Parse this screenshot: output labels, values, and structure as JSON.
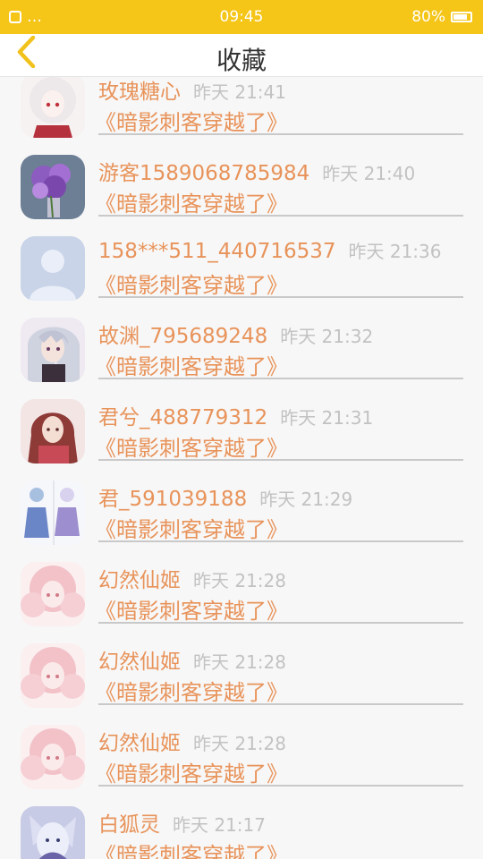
{
  "status_bar": {
    "time": "09:45",
    "carrier": "…",
    "battery": "80%"
  },
  "header": {
    "title": "收藏",
    "back_icon": "chevron-left-icon",
    "accent": "#f5c518"
  },
  "colors": {
    "name": "#e8935a",
    "time": "#c2c2c2",
    "book": "#e8935a"
  },
  "items": [
    {
      "name": "玫瑰糖心",
      "time": "昨天 21:41",
      "book": "《暗影刺客穿越了》",
      "avatar": "anime-girl-white-hair"
    },
    {
      "name": "游客1589068785984",
      "time": "昨天 21:40",
      "book": "《暗影刺客穿越了》",
      "avatar": "purple-hydrangea"
    },
    {
      "name": "158***511_440716537",
      "time": "昨天 21:36",
      "book": "《暗影刺客穿越了》",
      "avatar": "default-user"
    },
    {
      "name": "故渊_795689248",
      "time": "昨天 21:32",
      "book": "《暗影刺客穿越了》",
      "avatar": "anime-boy-silver-hair"
    },
    {
      "name": "君兮_488779312",
      "time": "昨天 21:31",
      "book": "《暗影刺客穿越了》",
      "avatar": "anime-girl-red-hair"
    },
    {
      "name": "君_591039188",
      "time": "昨天 21:29",
      "book": "《暗影刺客穿越了》",
      "avatar": "anime-dolls-blue-dress"
    },
    {
      "name": "幻然仙姬",
      "time": "昨天 21:28",
      "book": "《暗影刺客穿越了》",
      "avatar": "anime-girl-pink-hair"
    },
    {
      "name": "幻然仙姬",
      "time": "昨天 21:28",
      "book": "《暗影刺客穿越了》",
      "avatar": "anime-girl-pink-hair"
    },
    {
      "name": "幻然仙姬",
      "time": "昨天 21:28",
      "book": "《暗影刺客穿越了》",
      "avatar": "anime-girl-pink-hair"
    },
    {
      "name": "白狐灵",
      "time": "昨天 21:17",
      "book": "《暗影刺客穿越了》",
      "avatar": "anime-white-fox"
    }
  ]
}
